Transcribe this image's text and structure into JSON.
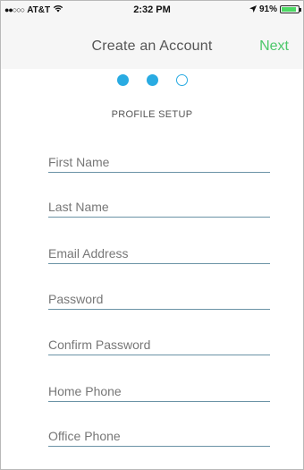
{
  "status_bar": {
    "signal": "●●○○○",
    "carrier": "AT&T",
    "wifi_icon": "wifi-icon",
    "time": "2:32 PM",
    "location_icon": "location-arrow-icon",
    "battery_percent": "91%",
    "battery_level": 0.91
  },
  "nav": {
    "title": "Create an Account",
    "next_label": "Next"
  },
  "steps": {
    "total": 3,
    "completed": 2
  },
  "section_label": "PROFILE SETUP",
  "form": {
    "first_name": {
      "placeholder": "First Name",
      "value": ""
    },
    "last_name": {
      "placeholder": "Last Name",
      "value": ""
    },
    "email": {
      "placeholder": "Email Address",
      "value": ""
    },
    "password": {
      "placeholder": "Password",
      "value": ""
    },
    "confirm_password": {
      "placeholder": "Confirm Password",
      "value": ""
    },
    "home_phone": {
      "placeholder": "Home Phone",
      "value": ""
    },
    "office_phone": {
      "placeholder": "Office Phone",
      "value": ""
    }
  },
  "colors": {
    "accent_blue": "#29abe2",
    "next_green": "#4cc76a",
    "battery_green": "#4cd964"
  }
}
